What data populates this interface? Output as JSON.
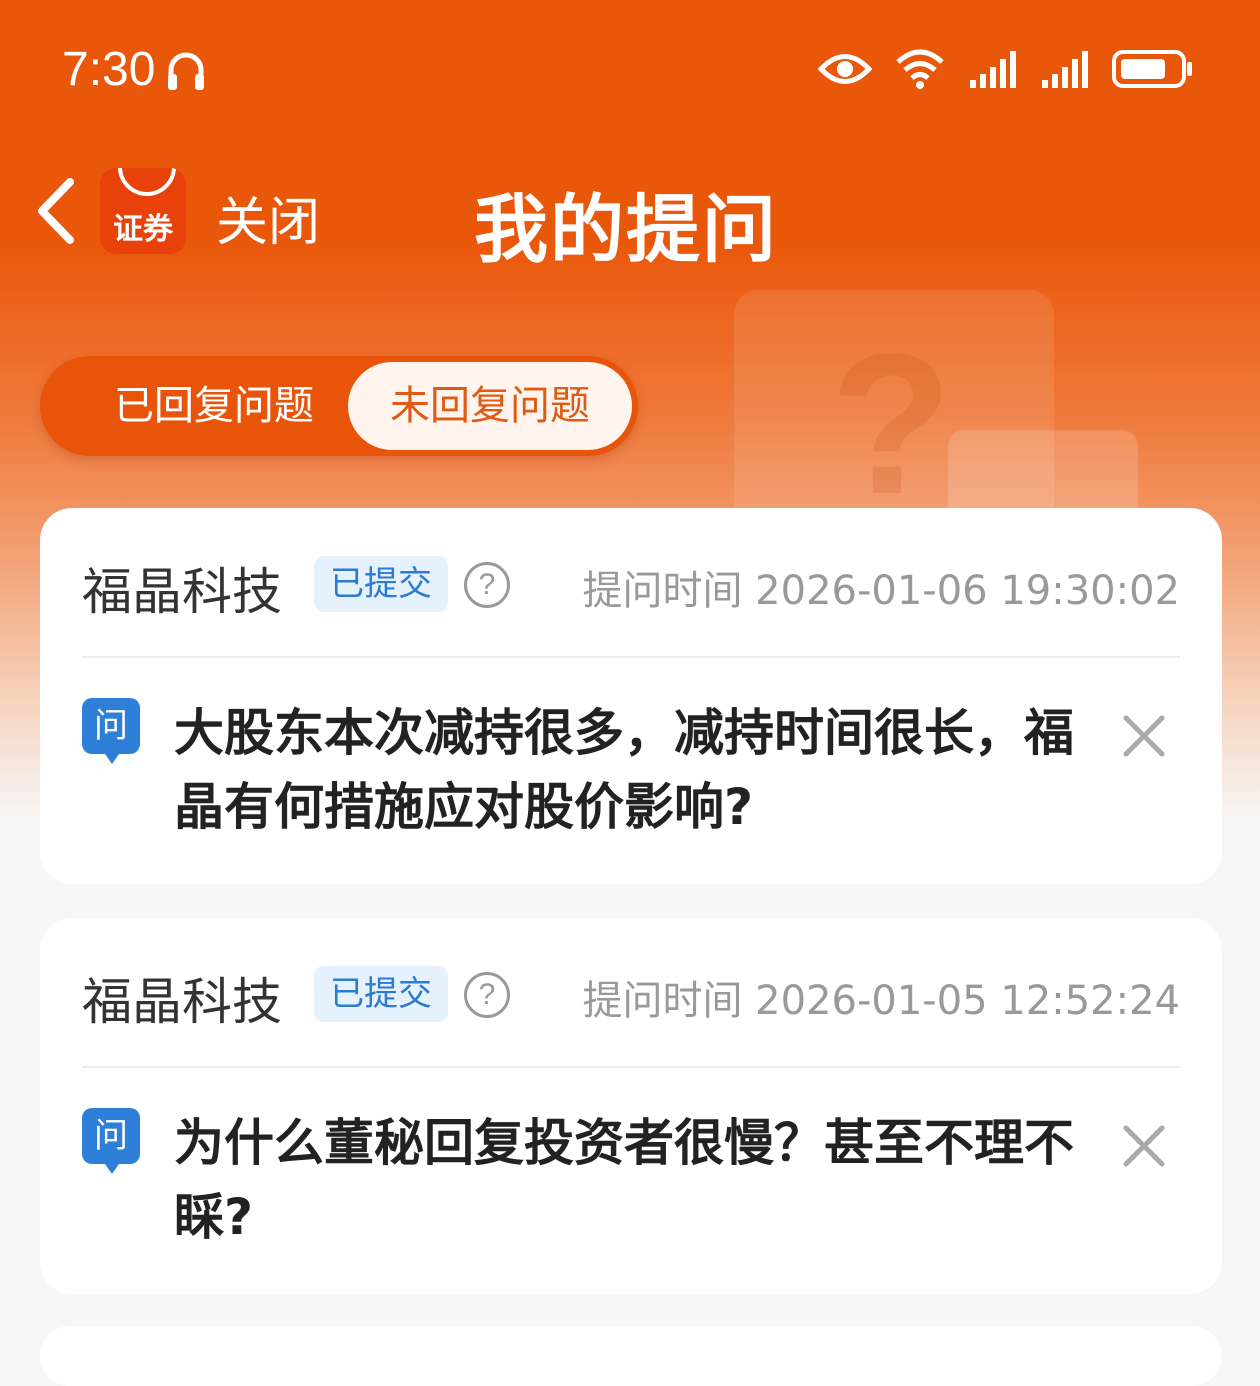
{
  "status_bar": {
    "time": "7:30",
    "icons": [
      "headset-icon",
      "eye-icon",
      "wifi-icon",
      "signal-icon",
      "signal-icon",
      "battery-icon"
    ]
  },
  "nav": {
    "back_icon": "chevron-left-icon",
    "app_logo_text": "证券",
    "close_label": "关闭",
    "title": "我的提问"
  },
  "tabs": [
    {
      "label": "已回复问题",
      "active": false
    },
    {
      "label": "未回复问题",
      "active": true
    }
  ],
  "questions": [
    {
      "company": "福晶科技",
      "status": "已提交",
      "time": "提问时间 2026-01-06 19:30:02",
      "q_label": "问",
      "text": "大股东本次减持很多，减持时间很长，福晶有何措施应对股价影响?"
    },
    {
      "company": "福晶科技",
      "status": "已提交",
      "time": "提问时间 2026-01-05 12:52:24",
      "q_label": "问",
      "text": "为什么董秘回复投资者很慢？甚至不理不睬?"
    }
  ],
  "colors": {
    "brand": "#e9570a",
    "badge_bg": "#e5f1fc",
    "badge_text": "#2b7bd0",
    "question_icon": "#2e7fd8"
  }
}
